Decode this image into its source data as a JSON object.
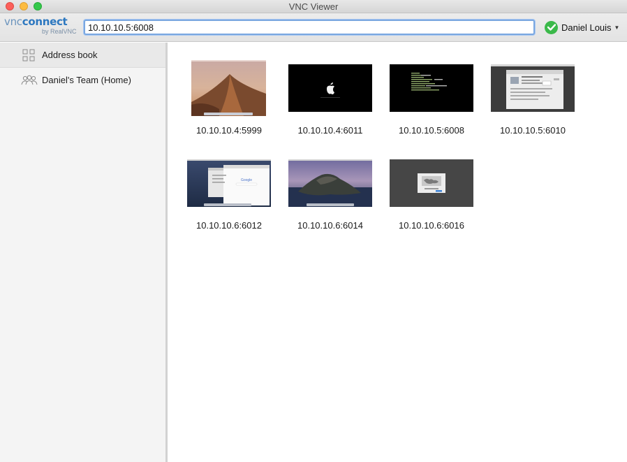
{
  "window": {
    "title": "VNC Viewer"
  },
  "logo": {
    "vnc": "vnc",
    "connect": "connect",
    "byline": "by RealVNC"
  },
  "address_bar": {
    "value": "10.10.10.5:6008"
  },
  "user": {
    "name": "Daniel Louis",
    "status": "signed-in",
    "status_color": "#3bb94a"
  },
  "sidebar": {
    "items": [
      {
        "label": "Address book",
        "icon": "grid-icon",
        "selected": true
      },
      {
        "label": "Daniel's Team (Home)",
        "icon": "team-icon",
        "selected": false
      }
    ]
  },
  "computers": [
    {
      "label": "10.10.10.4:5999",
      "thumb": "mojave-desert"
    },
    {
      "label": "10.10.10.4:6011",
      "thumb": "apple-boot"
    },
    {
      "label": "10.10.10.5:6008",
      "thumb": "terminal-boot"
    },
    {
      "label": "10.10.10.5:6010",
      "thumb": "settings-window"
    },
    {
      "label": "10.10.10.6:6012",
      "thumb": "browser-google"
    },
    {
      "label": "10.10.10.6:6014",
      "thumb": "catalina-island"
    },
    {
      "label": "10.10.10.6:6016",
      "thumb": "installer-map"
    }
  ]
}
